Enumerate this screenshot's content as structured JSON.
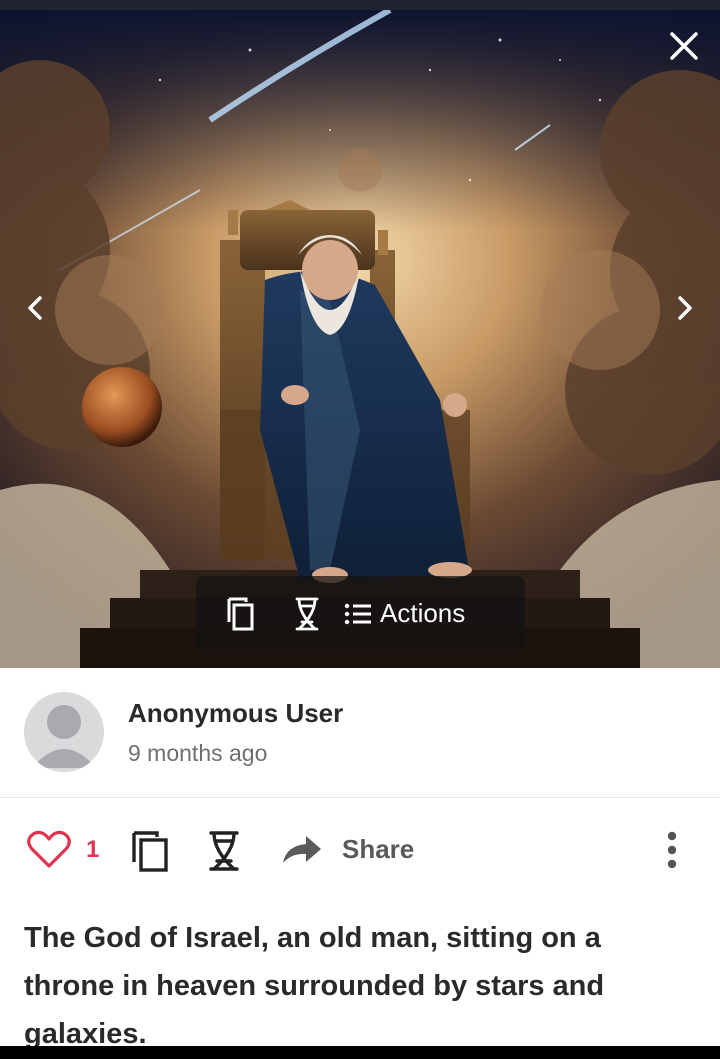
{
  "viewer": {
    "actions_label": "Actions",
    "icons": {
      "close": "close-icon",
      "prev": "chevron-left-icon",
      "next": "chevron-right-icon",
      "copy": "copy-icon",
      "remix": "dna-icon",
      "actions": "list-icon"
    }
  },
  "author": {
    "name": "Anonymous User",
    "time": "9 months ago"
  },
  "toolbar": {
    "like_count": "1",
    "share_label": "Share",
    "icons": {
      "like": "heart-icon",
      "copy": "copy-icon",
      "remix": "dna-icon",
      "share": "share-arrow-icon",
      "more": "more-vertical-icon"
    }
  },
  "prompt": {
    "text": "The God of Israel, an old man, sitting on a throne in heaven surrounded by stars and galaxies."
  },
  "colors": {
    "like": "#e0334f",
    "text": "#2a2a2a",
    "muted": "#707070",
    "pill_bg": "rgba(20,18,18,0.72)"
  }
}
